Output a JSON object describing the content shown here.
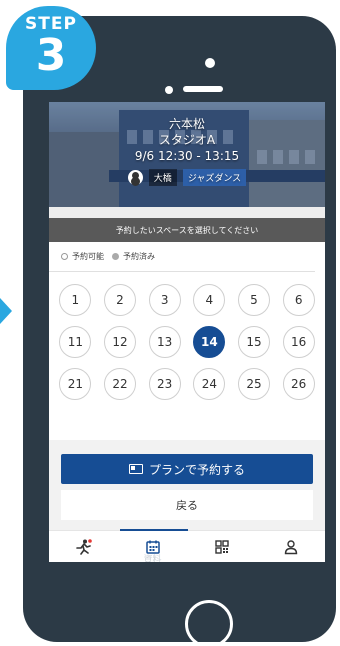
{
  "step": {
    "word": "STEP",
    "number": "3"
  },
  "hero": {
    "location": "六本松",
    "studio": "スタジオA",
    "datetime": "9/6  12:30 - 13:15",
    "instructor": "大橋",
    "program": "ジャズダンス"
  },
  "instruction": "予約したいスペースを選択してください",
  "legend": {
    "available": "予約可能",
    "reserved": "予約済み"
  },
  "spots": [
    "1",
    "2",
    "3",
    "4",
    "5",
    "6",
    "11",
    "12",
    "13",
    "14",
    "15",
    "16",
    "21",
    "22",
    "23",
    "24",
    "25",
    "26"
  ],
  "selected_spot": "14",
  "buttons": {
    "plan": "プランで予約する",
    "back": "戻る"
  },
  "tabbar": {
    "items": [
      "running-icon",
      "calendar-icon",
      "qr-code-icon",
      "person-icon"
    ],
    "active": "calendar-icon",
    "ghost_label": "資料"
  },
  "colors": {
    "accent": "#164d94",
    "badge": "#2aa7e0",
    "phone": "#2c3a46",
    "notification": "#e53935"
  }
}
